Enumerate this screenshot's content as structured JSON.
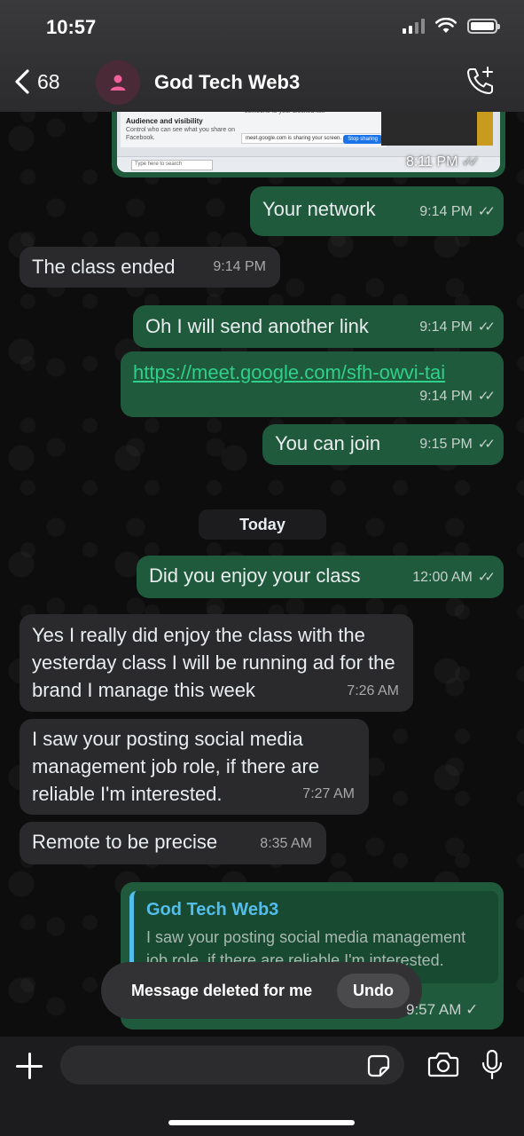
{
  "status": {
    "time": "10:57"
  },
  "header": {
    "back_count": "68",
    "title": "God Tech Web3"
  },
  "screenshot_preview": {
    "title": "Audience and visibility",
    "text": "Control who can see what you share on Facebook.",
    "blocked_text": "someone to your blocked list.",
    "share_text": "meet.google.com is sharing your screen.",
    "stop_label": "Stop sharing",
    "search_placeholder": "Type here to search",
    "time": "8:11 PM"
  },
  "messages": [
    {
      "text": "Your network",
      "time": "9:14 PM"
    },
    {
      "text": "The class ended",
      "time": "9:14 PM"
    },
    {
      "text": "Oh I will send another link",
      "time": "9:14 PM"
    },
    {
      "text": "https://meet.google.com/sfh-owvi-tai",
      "time": "9:14 PM"
    },
    {
      "text": "You can join",
      "time": "9:15 PM"
    },
    {
      "text": "Did you enjoy your class",
      "time": "12:00 AM"
    },
    {
      "text": "Yes I really did enjoy the class with the yesterday class I will be running ad for the brand I manage this week",
      "time": "7:26 AM"
    },
    {
      "text": "I saw your posting social media management job role, if there are reliable I'm interested.",
      "time": "7:27 AM"
    },
    {
      "text": "Remote to be precise",
      "time": "8:35 AM"
    }
  ],
  "day_label": "Today",
  "quote": {
    "name": "God Tech Web3",
    "text": "I saw your posting social media management job role, if there are reliable I'm interested."
  },
  "toast": {
    "text": "Message deleted for me",
    "undo_label": "Undo"
  },
  "last_time": "9:57 AM",
  "composer": {
    "placeholder": ""
  },
  "colors": {
    "outgoing": "#1f5a3c",
    "incoming": "#2a2a2c",
    "link": "#2fd08a",
    "quote_accent": "#53bdeb"
  }
}
